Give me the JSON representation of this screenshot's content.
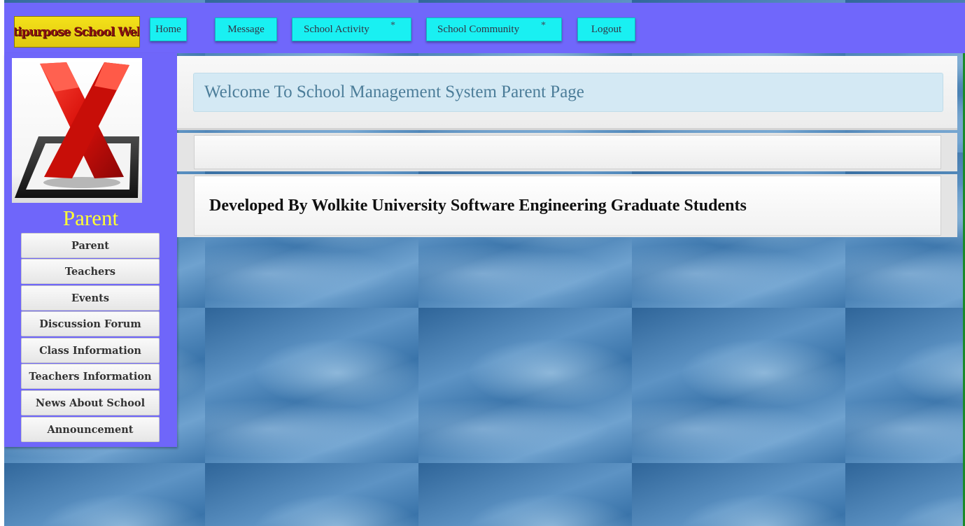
{
  "header": {
    "logo_text": "Multipurpose School Website",
    "nav": [
      {
        "label": "Home",
        "star": ""
      },
      {
        "label": "Message",
        "star": ""
      },
      {
        "label": "School Activity",
        "star": "*"
      },
      {
        "label": "School Community",
        "star": "*"
      },
      {
        "label": "Logout",
        "star": ""
      }
    ]
  },
  "sidebar": {
    "role_title": "Parent",
    "items": [
      {
        "label": "Parent"
      },
      {
        "label": "Teachers"
      },
      {
        "label": "Events"
      },
      {
        "label": "Discussion Forum"
      },
      {
        "label": "Class Information"
      },
      {
        "label": "Teachers Information"
      },
      {
        "label": "News About School"
      },
      {
        "label": "Announcement"
      }
    ]
  },
  "main": {
    "welcome": "Welcome To School Management System Parent Page",
    "footer": "Developed By Wolkite University Software Engineering Graduate Students"
  },
  "colors": {
    "topbar": "#7067fb",
    "nav_button": "#19f0f2",
    "role_title": "#ffff33",
    "welcome_box": "#d4e9f4",
    "welcome_text": "#4c7d99"
  },
  "icons": {
    "avatar": "red-x-mark-icon"
  }
}
